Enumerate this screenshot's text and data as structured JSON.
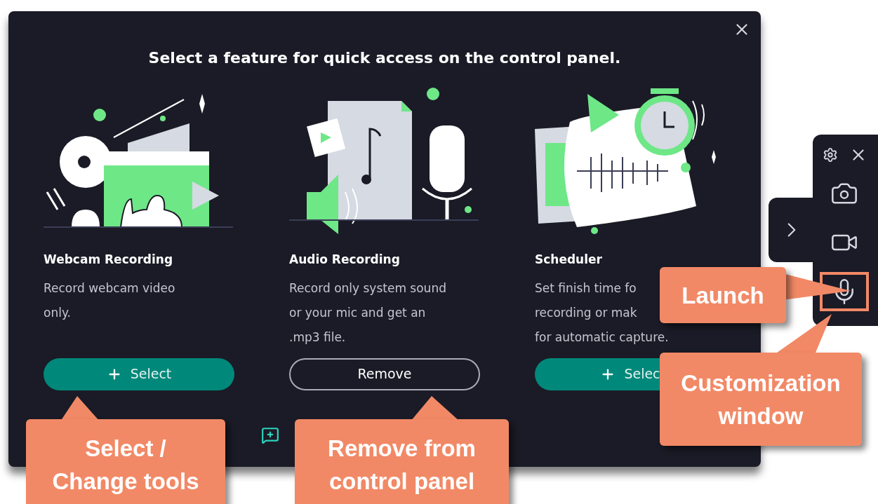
{
  "dialog": {
    "title": "Select a feature for quick access on the control panel.",
    "features": [
      {
        "kind": "webcam",
        "name": "Webcam Recording",
        "description": [
          "Record webcam video",
          "only."
        ],
        "button": {
          "kind": "select",
          "label": "Select"
        }
      },
      {
        "kind": "audio",
        "name": "Audio Recording",
        "description": [
          "Record only system sound",
          "or your mic and get an",
          ".mp3 file."
        ],
        "button": {
          "kind": "remove",
          "label": "Remove"
        }
      },
      {
        "kind": "scheduler",
        "name": "Scheduler",
        "description": [
          "Set finish time fo",
          "recording or mak",
          "for automatic capture."
        ],
        "button": {
          "kind": "select",
          "label": "Selec"
        }
      }
    ]
  },
  "control_panel": {
    "tools": [
      {
        "kind": "camera",
        "highlighted": false
      },
      {
        "kind": "video",
        "highlighted": false
      },
      {
        "kind": "mic",
        "highlighted": true
      }
    ]
  },
  "callouts": [
    {
      "kind": "select",
      "lines": [
        "Select /",
        "Change tools"
      ]
    },
    {
      "kind": "remove",
      "lines": [
        "Remove from",
        "control panel"
      ]
    },
    {
      "kind": "launch",
      "lines": [
        "Launch"
      ]
    },
    {
      "kind": "customize",
      "lines": [
        "Customization",
        "window"
      ]
    }
  ]
}
